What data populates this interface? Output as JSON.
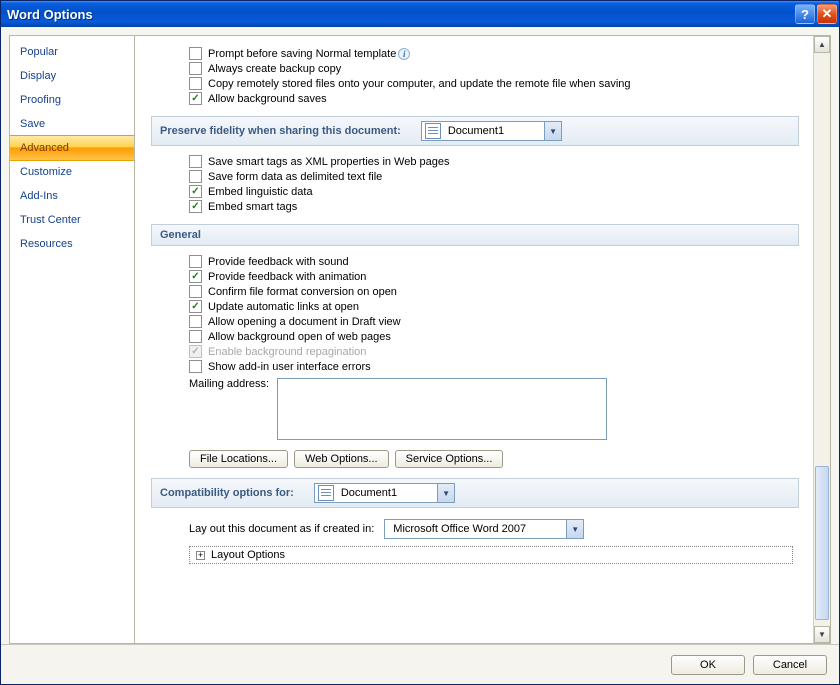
{
  "title": "Word Options",
  "sidebar": {
    "items": [
      {
        "label": "Popular"
      },
      {
        "label": "Display"
      },
      {
        "label": "Proofing"
      },
      {
        "label": "Save"
      },
      {
        "label": "Advanced"
      },
      {
        "label": "Customize"
      },
      {
        "label": "Add-Ins"
      },
      {
        "label": "Trust Center"
      },
      {
        "label": "Resources"
      }
    ],
    "selected": "Advanced"
  },
  "save_opts": {
    "prompt_normal": "Prompt before saving Normal template",
    "backup": "Always create backup copy",
    "copy_remote": "Copy remotely stored files onto your computer, and update the remote file when saving",
    "bg_saves": "Allow background saves"
  },
  "preserve_header": "Preserve fidelity when sharing this document:",
  "preserve_doc": "Document1",
  "preserve_opts": {
    "smart_xml": "Save smart tags as XML properties in Web pages",
    "form_data": "Save form data as delimited text file",
    "linguistic": "Embed linguistic data",
    "embed_smart": "Embed smart tags"
  },
  "general_header": "General",
  "general_opts": {
    "sound": "Provide feedback with sound",
    "anim": "Provide feedback with animation",
    "confirm_conv": "Confirm file format conversion on open",
    "auto_links": "Update automatic links at open",
    "draft": "Allow opening a document in Draft view",
    "bg_open": "Allow background open of web pages",
    "repag": "Enable background repagination",
    "addin_err": "Show add-in user interface errors",
    "mail_label": "Mailing address:"
  },
  "buttons": {
    "file_loc": "File Locations...",
    "web_opt": "Web Options...",
    "svc_opt": "Service Options..."
  },
  "compat_header": "Compatibility options for:",
  "compat_doc": "Document1",
  "layout_label": "Lay out this document as if created in:",
  "layout_value": "Microsoft Office Word 2007",
  "layout_tree": "Layout Options",
  "footer": {
    "ok": "OK",
    "cancel": "Cancel"
  }
}
